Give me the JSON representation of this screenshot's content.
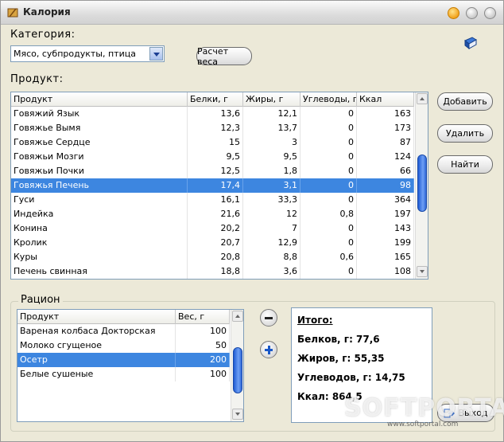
{
  "window": {
    "title": "Калория"
  },
  "category": {
    "label": "Категория:",
    "selected": "Мясо, субпродукты, птица"
  },
  "buttons": {
    "calc_weight": "Расчет веса",
    "add": "Добавить",
    "delete": "Удалить",
    "find": "Найти",
    "exit": "Выход"
  },
  "product": {
    "label": "Продукт:",
    "columns": [
      "Продукт",
      "Белки, г",
      "Жиры, г",
      "Углеводы, г",
      "Ккал"
    ],
    "rows": [
      [
        "Говяжий Язык",
        "13,6",
        "12,1",
        "0",
        "163"
      ],
      [
        "Говяжье Вымя",
        "12,3",
        "13,7",
        "0",
        "173"
      ],
      [
        "Говяжье Сердце",
        "15",
        "3",
        "0",
        "87"
      ],
      [
        "Говяжьи Мозги",
        "9,5",
        "9,5",
        "0",
        "124"
      ],
      [
        "Говяжьи Почки",
        "12,5",
        "1,8",
        "0",
        "66"
      ],
      [
        "Говяжья Печень",
        "17,4",
        "3,1",
        "0",
        "98"
      ],
      [
        "Гуси",
        "16,1",
        "33,3",
        "0",
        "364"
      ],
      [
        "Индейка",
        "21,6",
        "12",
        "0,8",
        "197"
      ],
      [
        "Конина",
        "20,2",
        "7",
        "0",
        "143"
      ],
      [
        "Кролик",
        "20,7",
        "12,9",
        "0",
        "199"
      ],
      [
        "Куры",
        "20,8",
        "8,8",
        "0,6",
        "165"
      ],
      [
        "Печень свинная",
        "18,8",
        "3,6",
        "0",
        "108"
      ]
    ],
    "selected_index": 5
  },
  "ration": {
    "label": "Рацион",
    "columns": [
      "Продукт",
      "Вес, г"
    ],
    "rows": [
      [
        "Вареная колбаса Докторская",
        "100"
      ],
      [
        "Молоко сгущеное",
        "50"
      ],
      [
        "Осетр",
        "200"
      ],
      [
        "Белые сушеные",
        "100"
      ]
    ],
    "selected_index": 2
  },
  "totals": {
    "title": "Итого:",
    "protein": "Белков, г: 77,6",
    "fat": "Жиров, г: 55,35",
    "carbs": "Углеводов, г: 14,75",
    "kcal": "Ккал: 864,5"
  },
  "watermark": {
    "text": "SOFTPORTAL",
    "url": "www.softportal.com"
  },
  "icons": {
    "app": "app-icon",
    "book": "book-icon",
    "minus": "minus-icon",
    "plus": "plus-icon",
    "exit": "exit-icon"
  },
  "colors": {
    "selection": "#3d86e0",
    "scroll_thumb": "#2d66d6"
  }
}
